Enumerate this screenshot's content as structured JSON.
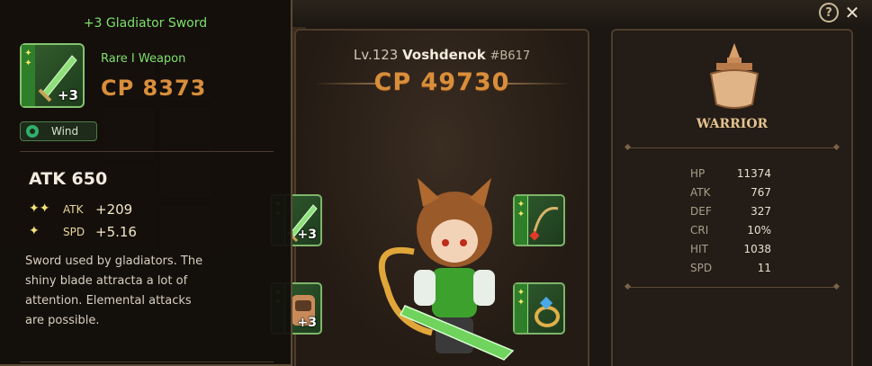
{
  "tooltip": {
    "title": "+3 Gladiator Sword",
    "rarity": "Rare I Weapon",
    "cp": "CP 8373",
    "element": "Wind",
    "item_plus": "+3",
    "main_stat": "ATK 650",
    "sub_stats": [
      {
        "stars": "✦✦",
        "label": "ATK",
        "value": "+209"
      },
      {
        "stars": "✦",
        "label": "SPD",
        "value": "+5.16"
      }
    ],
    "description": "Sword used by gladiators. The\nshiny blade attracta a lot of\nattention. Elemental attacks\nare possible."
  },
  "character": {
    "level": "Lv.123",
    "name": "Voshdenok",
    "tag": "#B617",
    "cp": "CP 49730",
    "equipment": [
      {
        "slot": "weapon",
        "plus": "+3"
      },
      {
        "slot": "armor",
        "plus": "+3"
      },
      {
        "slot": "necklace",
        "plus": ""
      },
      {
        "slot": "ring",
        "plus": ""
      }
    ]
  },
  "stats_panel": {
    "class_name": "WARRIOR",
    "stats": [
      {
        "label": "HP",
        "value": "11374"
      },
      {
        "label": "ATK",
        "value": "767"
      },
      {
        "label": "DEF",
        "value": "327"
      },
      {
        "label": "CRI",
        "value": "10%"
      },
      {
        "label": "HIT",
        "value": "1038"
      },
      {
        "label": "SPD",
        "value": "11"
      }
    ]
  },
  "window": {
    "help_label": "?",
    "close_label": "✕"
  },
  "colors": {
    "rarity_green": "#7ee06a",
    "cp_orange": "#d98e3b",
    "class_gold": "#e2c38f"
  }
}
